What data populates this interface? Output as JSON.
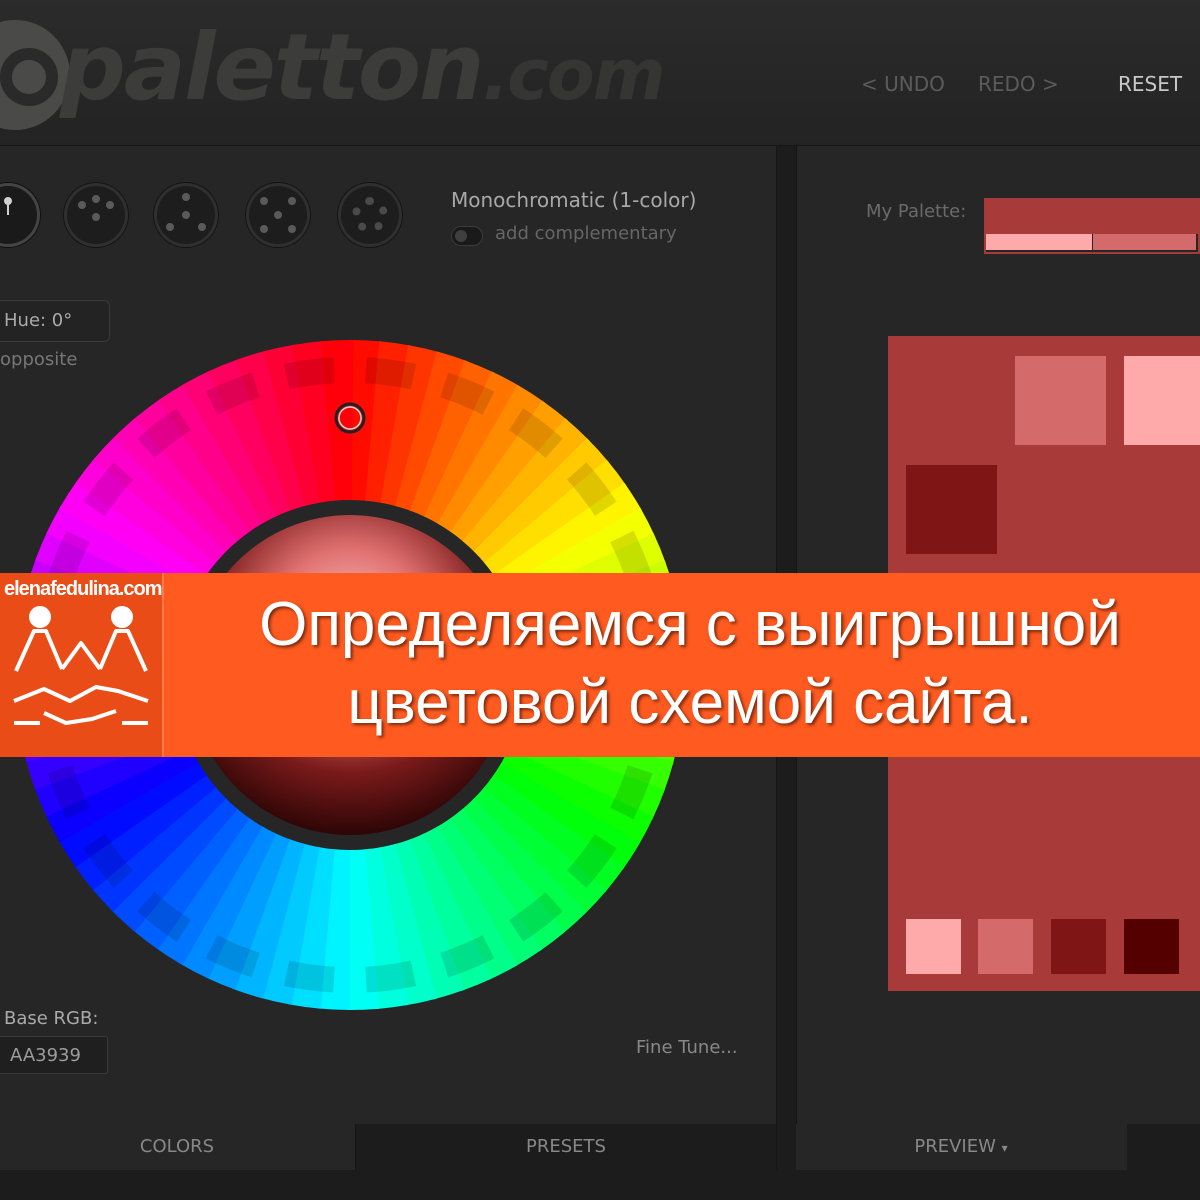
{
  "header": {
    "logo_text": "paletton",
    "logo_suffix": ".com",
    "undo_label": "< UNDO",
    "redo_label": "REDO >",
    "reset_label": "RESET"
  },
  "scheme": {
    "title": "Monochromatic (1-color)",
    "toggle_label": "add complementary",
    "icons": [
      "mono-icon",
      "adjacent-icon",
      "triad-icon",
      "tetrad-icon",
      "freestyle-gear-icon"
    ]
  },
  "wheel": {
    "hue_label": "Hue: 0°",
    "opposite_label": "opposite",
    "hue_value": 0
  },
  "base": {
    "label": "Base RGB:",
    "value": "AA3939",
    "fine_tune": "Fine Tune..."
  },
  "tabs": {
    "colors": "COLORS",
    "presets": "PRESETS",
    "preview": "PREVIEW",
    "preview_arrow": "▾"
  },
  "palette": {
    "label": "My Palette:",
    "main": "#a83a3a",
    "shade1": "#ffaaaa",
    "shade2": "#d46a6a",
    "shade3": "#801515",
    "shade4": "#550000"
  },
  "banner": {
    "domain": "elenafedulina.com",
    "line1": "Определяемся с выигрышной",
    "line2": "цветовой схемой сайта.",
    "color": "#ff5a1f"
  }
}
